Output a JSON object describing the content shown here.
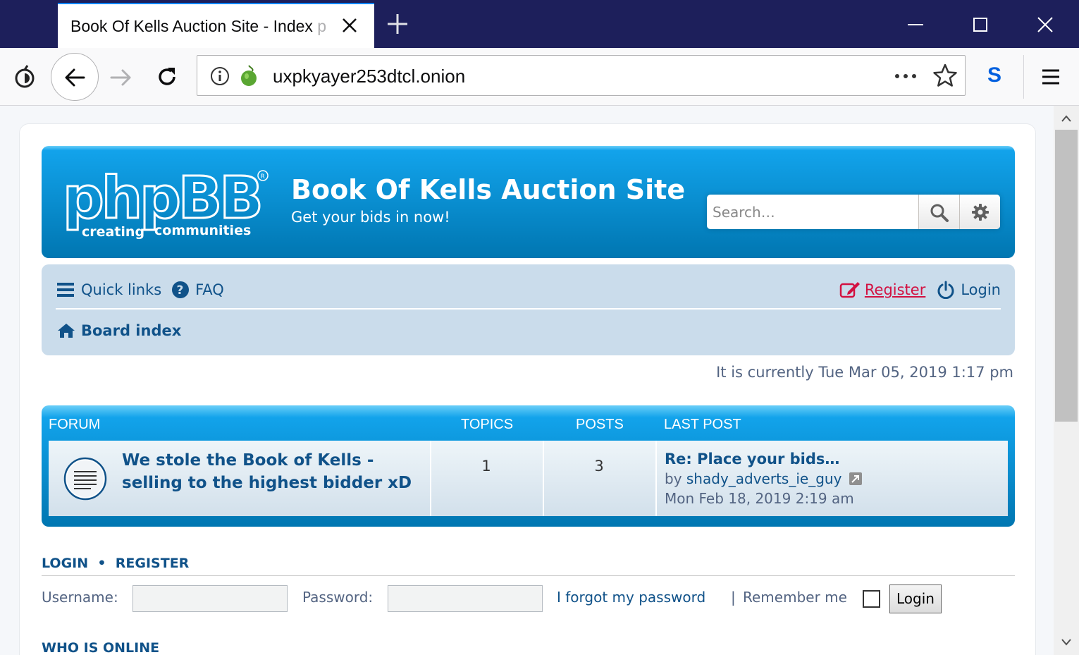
{
  "browser": {
    "tab_title": "Book Of Kells Auction Site - Index ",
    "tab_title_fade": "p",
    "url": "uxpkyayer253dtcl.onion",
    "extension_letter": "S"
  },
  "header": {
    "logo_text": "phpBB",
    "logo_tagline_left": "creating",
    "logo_tagline_right": "communities",
    "site_title": "Book Of Kells Auction Site",
    "site_desc": "Get your bids in now!",
    "search_placeholder": "Search…"
  },
  "nav": {
    "quick_links": "Quick links",
    "faq": "FAQ",
    "register": "Register",
    "login": "Login",
    "board_index": "Board index"
  },
  "datetime": "It is currently Tue Mar 05, 2019 1:17 pm",
  "forum_table": {
    "headers": {
      "forum": "FORUM",
      "topics": "TOPICS",
      "posts": "POSTS",
      "last_post": "LAST POST"
    },
    "rows": [
      {
        "title": "We stole the Book of Kells - selling to the highest bidder xD",
        "topics": "1",
        "posts": "3",
        "last_post_title": "Re: Place your bids…",
        "last_post_by": "by",
        "last_post_user": "shady_adverts_ie_guy",
        "last_post_date": "Mon Feb 18, 2019 2:19 am"
      }
    ]
  },
  "login_section": {
    "login": "LOGIN",
    "bullet": "•",
    "register": "REGISTER",
    "username_label": "Username:",
    "password_label": "Password:",
    "forgot": "I forgot my password",
    "pipe": "|",
    "remember": "Remember me",
    "login_button": "Login"
  },
  "who_is_online": "WHO IS ONLINE",
  "colors": {
    "header_blue": "#0076b1",
    "link_blue": "#105289",
    "register_red": "#d31141",
    "nav_panel": "#cadceb",
    "tab_bar": "#1d1f5b"
  }
}
